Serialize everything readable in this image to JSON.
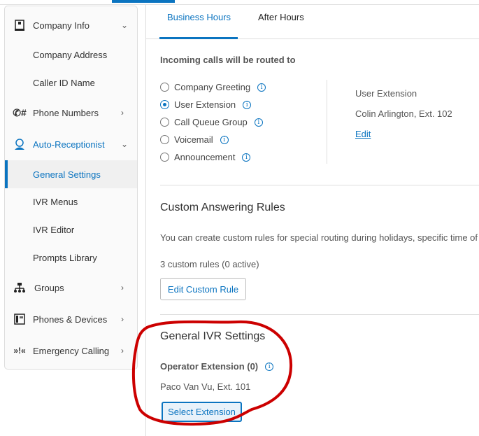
{
  "sidebar": {
    "items": [
      {
        "label": "Company Info",
        "icon": "building-icon",
        "chevron": "down"
      },
      {
        "label": "Company Address"
      },
      {
        "label": "Caller ID Name"
      },
      {
        "label": "Phone Numbers",
        "icon": "phone-hash-icon",
        "chevron": "right"
      },
      {
        "label": "Auto-Receptionist",
        "icon": "receptionist-icon",
        "chevron": "down"
      },
      {
        "label": "General Settings",
        "active": true
      },
      {
        "label": "IVR Menus"
      },
      {
        "label": "IVR Editor"
      },
      {
        "label": "Prompts Library"
      },
      {
        "label": "Groups",
        "icon": "org-chart-icon",
        "chevron": "right"
      },
      {
        "label": "Phones & Devices",
        "icon": "desk-phone-icon",
        "chevron": "right"
      },
      {
        "label": "Emergency Calling",
        "icon": "emergency-icon",
        "chevron": "right"
      }
    ]
  },
  "tabs": [
    {
      "label": "Business Hours",
      "active": true
    },
    {
      "label": "After Hours"
    }
  ],
  "routing": {
    "heading": "Incoming calls will be routed to",
    "options": [
      {
        "label": "Company Greeting",
        "selected": false
      },
      {
        "label": "User Extension",
        "selected": true
      },
      {
        "label": "Call Queue Group",
        "selected": false
      },
      {
        "label": "Voicemail",
        "selected": false
      },
      {
        "label": "Announcement",
        "selected": false
      }
    ],
    "detail_type": "User Extension",
    "detail_value": "Colin Arlington, Ext. 102",
    "edit_label": "Edit"
  },
  "custom_rules": {
    "title": "Custom Answering Rules",
    "description": "You can create custom rules for special routing during holidays, specific time of",
    "count": "3 custom rules (0 active)",
    "button": "Edit Custom Rule"
  },
  "ivr": {
    "title": "General IVR Settings",
    "operator_label": "Operator Extension (0)",
    "operator_value": "Paco Van Vu, Ext. 101",
    "button": "Select Extension"
  },
  "colors": {
    "accent": "#0b74c0",
    "annotation": "#cc0000"
  }
}
